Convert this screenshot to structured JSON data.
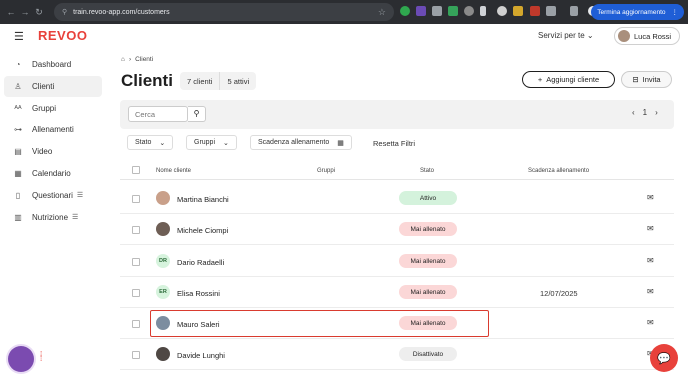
{
  "browser": {
    "url": "train.revoo-app.com/customers",
    "update_label": "Termina aggiornamento"
  },
  "app": {
    "logo": "REVOO",
    "services_label": "Servizi per te",
    "user_name": "Luca Rossi"
  },
  "sidebar": {
    "items": [
      {
        "label": "Dashboard",
        "icon": "gauge-icon"
      },
      {
        "label": "Clienti",
        "icon": "person-icon"
      },
      {
        "label": "Gruppi",
        "icon": "group-icon"
      },
      {
        "label": "Allenamenti",
        "icon": "dumbbell-icon"
      },
      {
        "label": "Video",
        "icon": "film-icon"
      },
      {
        "label": "Calendario",
        "icon": "calendar-icon"
      },
      {
        "label": "Questionari",
        "icon": "form-icon"
      },
      {
        "label": "Nutrizione",
        "icon": "nutrition-icon"
      }
    ]
  },
  "page": {
    "breadcrumb": "Clienti",
    "title": "Clienti",
    "total_clients": "7 clienti",
    "active_clients": "5 attivi",
    "add_button": "Aggiungi cliente",
    "invite_button": "Invita"
  },
  "search": {
    "placeholder": "Cerca",
    "page_number": "1"
  },
  "filters": {
    "stato": "Stato",
    "gruppi": "Gruppi",
    "scadenza": "Scadenza allenamento",
    "reset": "Resetta Filtri"
  },
  "table": {
    "headers": {
      "name": "Nome cliente",
      "groups": "Gruppi",
      "status": "Stato",
      "deadline": "Scadenza allenamento"
    },
    "rows": [
      {
        "name": "Martina Bianchi",
        "initials": "",
        "status": "Attivo",
        "deadline": ""
      },
      {
        "name": "Michele Ciompi",
        "initials": "",
        "status": "Mai allenato",
        "deadline": ""
      },
      {
        "name": "Dario Radaelli",
        "initials": "DR",
        "status": "Mai allenato",
        "deadline": ""
      },
      {
        "name": "Elisa Rossini",
        "initials": "ER",
        "status": "Mai allenato",
        "deadline": "12/07/2025"
      },
      {
        "name": "Mauro Saleri",
        "initials": "",
        "status": "Mai allenato",
        "deadline": ""
      },
      {
        "name": "Davide Lunghi",
        "initials": "",
        "status": "Disattivato",
        "deadline": ""
      }
    ]
  },
  "colors": {
    "brand": "#e8413b",
    "status_active_bg": "#d4f2dc",
    "status_never_bg": "#fbd7d7",
    "status_disabled_bg": "#eeeeee"
  }
}
